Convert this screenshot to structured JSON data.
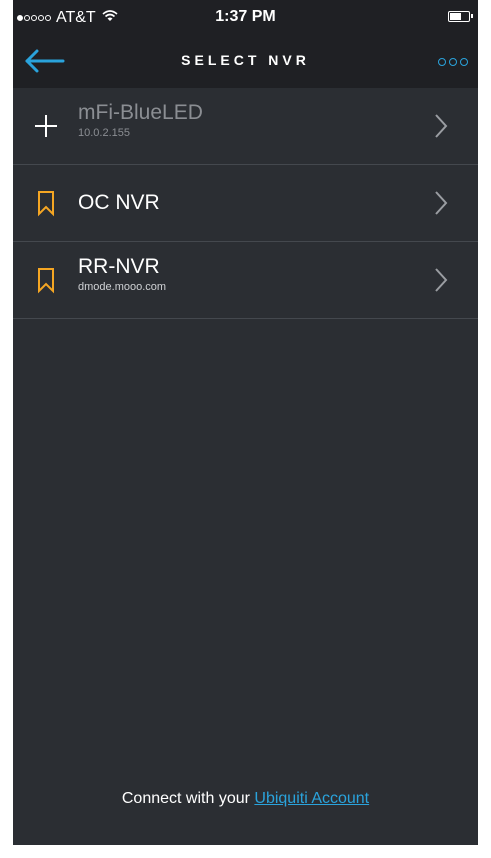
{
  "status_bar": {
    "carrier": "AT&T",
    "time": "1:37 PM",
    "signal_bars_filled": 1,
    "signal_bars_total": 5
  },
  "nav": {
    "title": "SELECT NVR",
    "back_icon": "arrow-left-icon",
    "more_icon": "more-icon"
  },
  "colors": {
    "background": "#2b2e33",
    "bar": "#1f2024",
    "accent": "#2aa3dc",
    "bookmark": "#f5a623"
  },
  "nvrs": [
    {
      "icon": "plus-icon",
      "name": "mFi-BlueLED",
      "address": "10.0.2.155",
      "discovered": true
    },
    {
      "icon": "bookmark-icon",
      "name": "OC NVR",
      "address": "",
      "discovered": false
    },
    {
      "icon": "bookmark-icon",
      "name": "RR-NVR",
      "address": "dmode.mooo.com",
      "discovered": false
    }
  ],
  "footer": {
    "prefix": "Connect with your ",
    "link": "Ubiquiti Account"
  }
}
